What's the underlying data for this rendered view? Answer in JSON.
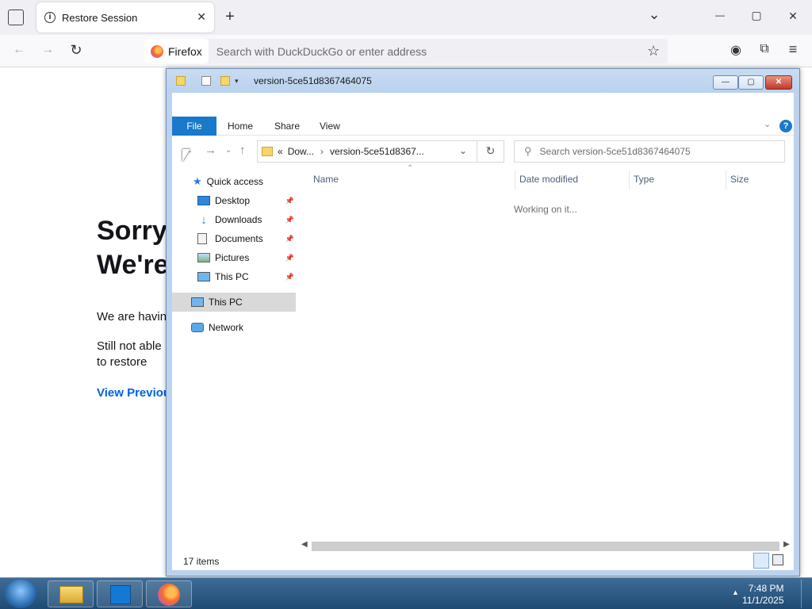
{
  "firefox": {
    "tab_title": "Restore Session",
    "identity_label": "Firefox",
    "search_placeholder": "Search with DuckDuckGo or enter address",
    "tab_info_glyph": "i",
    "glyphs": {
      "close": "✕",
      "new_tab": "+",
      "list_tabs": "⌄",
      "minimize": "—",
      "maximize": "▢",
      "window_close": "✕",
      "back": "←",
      "forward": "→",
      "reload": "↻",
      "bookmark": "☆",
      "account": "◉",
      "extensions": "⧉",
      "menu": "≡"
    }
  },
  "page": {
    "heading": "Sorry. We're having trouble getting your pages back.",
    "body1": "We are having trouble restoring your last browsing session.",
    "body2": "Still not able to restore your session? Sometimes a tab is causing the issue. View previous tabs, remove the checkmark from the tabs you don't need to recover, and then restore.",
    "link": "View Previous Tabs"
  },
  "explorer": {
    "title": "version-5ce51d8367464075",
    "ribbon_tabs": {
      "file": "File",
      "home": "Home",
      "share": "Share",
      "view": "View"
    },
    "help_glyph": "?",
    "address": {
      "prefix": "«",
      "crumb1": "Dow...",
      "sep": "›",
      "crumb2": "version-5ce51d8367..."
    },
    "search_placeholder": "Search version-5ce51d8367464075",
    "nav": {
      "quick_access": "Quick access",
      "desktop": "Desktop",
      "downloads": "Downloads",
      "documents": "Documents",
      "pictures": "Pictures",
      "this_pc_pinned": "This PC",
      "this_pc": "This PC",
      "network": "Network"
    },
    "columns": {
      "name": "Name",
      "date_modified": "Date modified",
      "type": "Type",
      "size": "Size"
    },
    "status_working": "Working on it...",
    "item_count": "17 items"
  },
  "taskbar": {
    "time": "7:48 PM",
    "date": "11/1/2025"
  }
}
